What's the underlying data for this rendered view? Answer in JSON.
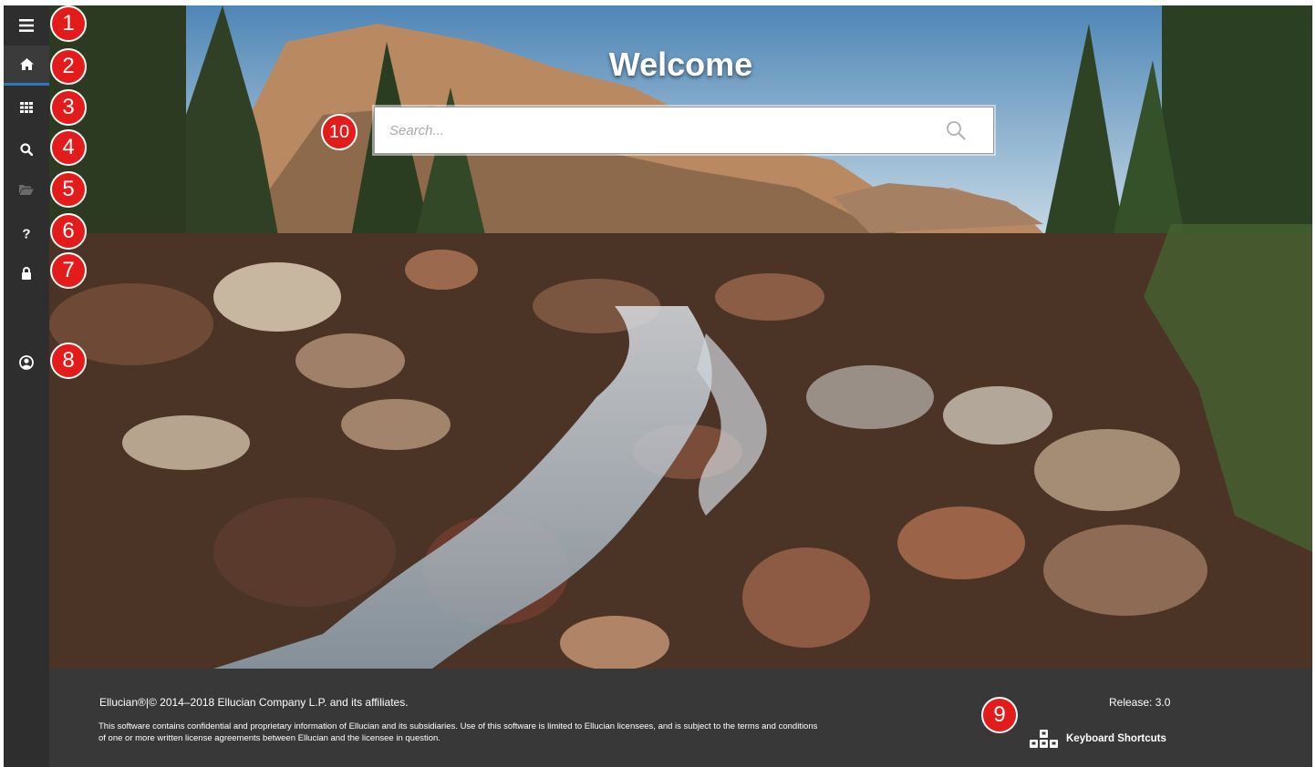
{
  "sidebar": {
    "items": [
      {
        "name": "menu",
        "icon": "hamburger-menu-icon"
      },
      {
        "name": "home",
        "icon": "home-icon",
        "active": true
      },
      {
        "name": "applications",
        "icon": "grid-icon"
      },
      {
        "name": "search",
        "icon": "search-icon"
      },
      {
        "name": "recently-opened",
        "icon": "folder-open-icon"
      },
      {
        "name": "help",
        "icon": "question-icon"
      },
      {
        "name": "sign-out",
        "icon": "lock-icon"
      },
      {
        "name": "user-profile",
        "icon": "user-circle-icon"
      }
    ],
    "accent_color": "#2d77b8"
  },
  "main": {
    "title": "Welcome",
    "search": {
      "placeholder": "Search...",
      "value": ""
    }
  },
  "footer": {
    "copyright": "Ellucian®|© 2014–2018 Ellucian Company L.P. and its affiliates.",
    "legal": "This software contains confidential and proprietary information of Ellucian and its subsidiaries. Use of this software is limited to Ellucian licensees, and is subject to the terms and conditions of one or more written license agreements between Ellucian and the licensee in question.",
    "release": "Release: 3.0",
    "keyboard_shortcuts": "Keyboard Shortcuts"
  },
  "annotations": [
    "1",
    "2",
    "3",
    "4",
    "5",
    "6",
    "7",
    "8",
    "9",
    "10"
  ],
  "colors": {
    "badge": "#e31b1b",
    "footer_bg": "#383838",
    "sidebar_bg": "#2e2e2e"
  }
}
